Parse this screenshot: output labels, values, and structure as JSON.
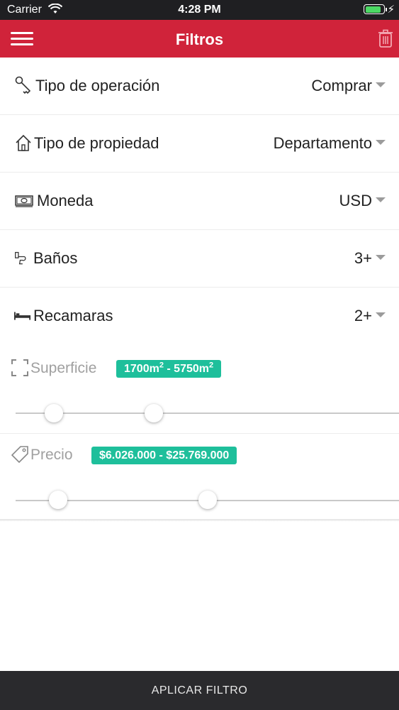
{
  "status_bar": {
    "carrier": "Carrier",
    "time": "4:28 PM",
    "battery_level": 0.9
  },
  "nav": {
    "title": "Filtros",
    "menu_icon": "hamburger-icon",
    "trash_icon": "trash-icon"
  },
  "filters": [
    {
      "label": "Tipo de operación",
      "value": "Comprar",
      "icon": "key-icon"
    },
    {
      "label": "Tipo de propiedad",
      "value": "Departamento",
      "icon": "house-icon"
    },
    {
      "label": "Moneda",
      "value": "USD",
      "icon": "money-icon"
    },
    {
      "label": "Baños",
      "value": "3+",
      "icon": "toilet-icon"
    },
    {
      "label": "Recamaras",
      "value": "2+",
      "icon": "bed-icon"
    }
  ],
  "superficie": {
    "label": "Superficie",
    "icon": "expand-icon",
    "min_text": "1700m",
    "max_text": "5750m",
    "unit_exponent": "2",
    "separator": " - ",
    "slider_min_fraction": 0.1,
    "slider_max_fraction": 0.36
  },
  "precio": {
    "label": "Precio",
    "icon": "price-tag-icon",
    "range_text": "$6.026.000 - $25.769.000",
    "slider_min_fraction": 0.11,
    "slider_max_fraction": 0.5
  },
  "apply_button": {
    "label": "APLICAR FILTRO"
  },
  "colors": {
    "accent": "#d0233a",
    "badge": "#1ebf9b",
    "bottom_bar": "#2a2a2d"
  }
}
